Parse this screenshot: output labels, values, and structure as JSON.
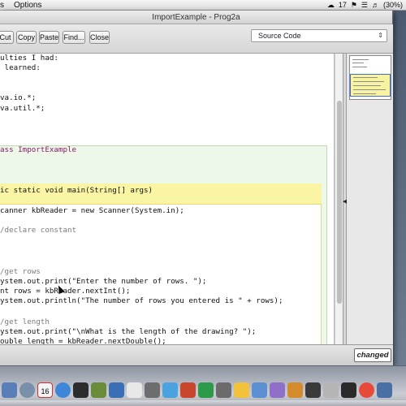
{
  "menubar": {
    "apple_menu": "s",
    "options_menu": "Options",
    "status_items": [
      "17",
      "(30%)"
    ]
  },
  "window": {
    "title": "ImportExample - Prog2a"
  },
  "toolbar": {
    "cut": "Cut",
    "copy": "Copy",
    "paste": "Paste",
    "find": "Find...",
    "close": "Close",
    "mode_value": "Source Code"
  },
  "code_lines": [
    "ulties I had:",
    " learned:",
    "",
    "va.io.*;",
    "va.util.*;",
    "",
    "",
    "ass ImportExample",
    "",
    "",
    "ic static void main(String[] args)",
    "",
    "canner kbReader = new Scanner(System.in);",
    "",
    "/declare constant",
    "",
    "",
    "",
    "/get rows",
    "ystem.out.print(\"Enter the number of rows. \");",
    "nt rows = kbReader.nextInt();",
    "ystem.out.println(\"The number of rows you entered is \" + rows);",
    "",
    "/get length",
    "ystem.out.print(\"\\nWhat is the length of the drawing? \");",
    "ouble length = kbReader.nextDouble();"
  ],
  "status": {
    "changed_label": "changed"
  },
  "colors": {
    "class_scope": "#eef8e8",
    "method_header": "#f9f5a5",
    "keyword": "#8a1a6e",
    "string": "#1a2aa0",
    "comment": "#7b7b7b"
  },
  "dock": {
    "calendar_day": "16"
  }
}
